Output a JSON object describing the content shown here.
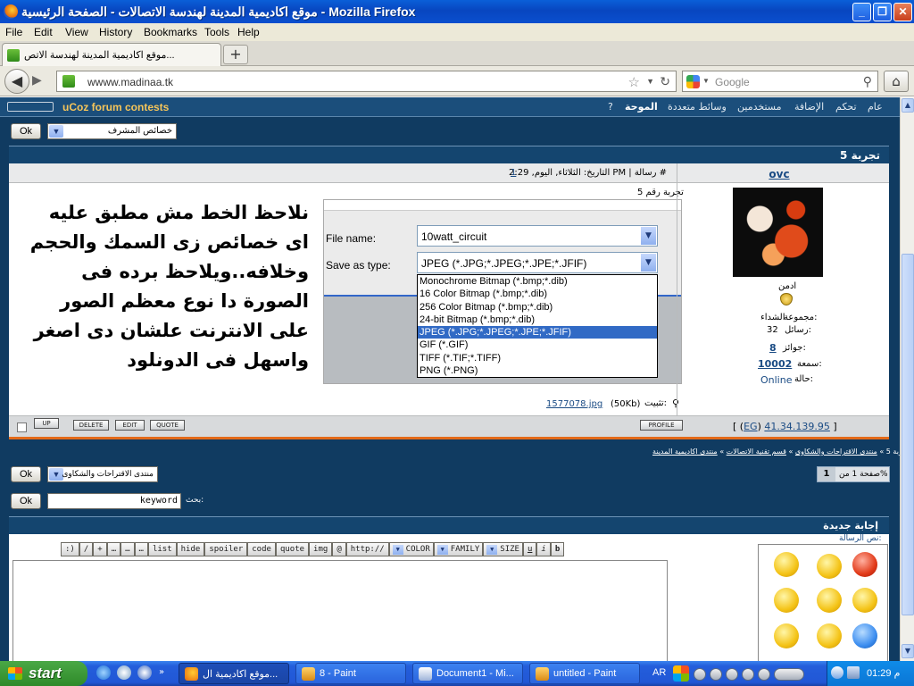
{
  "window": {
    "title": "موقع اكاديمية المدينة لهندسة الاتصالات - الصفحة الرئيسية - Mozilla Firefox",
    "buttons": [
      "_",
      "❐",
      "✕"
    ]
  },
  "menu": {
    "file": "File",
    "edit": "Edit",
    "view": "View",
    "history": "History",
    "bookmarks": "Bookmarks",
    "tools": "Tools",
    "help": "Help"
  },
  "tab": {
    "title": "موقع اكاديمية المدينة لهندسة الاتص...",
    "new_tab": "+"
  },
  "nav": {
    "url": "wwww.madinaa.tk",
    "search_placeholder": "Google"
  },
  "ucoz_bar": {
    "contests": "uCoz forum contests",
    "links": [
      "عام",
      "تحكم",
      "الإضافة",
      "مستخدمين",
      "وسائط متعددة",
      "الموحة"
    ],
    "question": "?"
  },
  "mod_select": {
    "ok": "Ok",
    "value": "خصائص المشرف"
  },
  "post": {
    "title": "تجربة 5",
    "meta": "التاريخ: الثلاثاء, اليوم, 2:29 PM | رسالة #",
    "msg_num": "1",
    "subject": "تجربة رقم 5",
    "note": "نلاحظ الخط مش مطبق عليه اى خصائص زى السمك والحجم وخلافه..ويلاحظ برده فى الصورة دا نوع معظم الصور على الانترنت علشان دى اصغر واسهل فى الدونلود",
    "attachment_label": "تثبيت:",
    "attachment_file": "1577078.jpg",
    "attachment_size": "(50Kb)",
    "save_dialog": {
      "file_name_label": "File name:",
      "file_name_value": "10watt_circuit",
      "save_type_label": "Save as type:",
      "save_type_value": "JPEG (*.JPG;*.JPEG;*.JPE;*.JFIF)",
      "options": [
        "Monochrome Bitmap (*.bmp;*.dib)",
        "16 Color Bitmap (*.bmp;*.dib)",
        "256 Color Bitmap (*.bmp;*.dib)",
        "24-bit Bitmap (*.bmp;*.dib)",
        "JPEG (*.JPG;*.JPEG;*.JPE;*.JFIF)",
        "GIF (*.GIF)",
        "TIFF (*.TIF;*.TIFF)",
        "PNG (*.PNG)"
      ]
    },
    "buttons": {
      "up": "UP",
      "delete": "DELETE",
      "edit": "EDIT",
      "quote": "QUOTE",
      "profile": "PROFILE"
    },
    "ip_prefix": "[ (",
    "ip_eg": "EG",
    "ip_mid": ") ",
    "ip": "41.34.139.95",
    "ip_suffix": " ]"
  },
  "user": {
    "name": "ovc",
    "rank": "ادمن",
    "group_label": "مجموعة:",
    "group": "الشداء",
    "messages_label": "رسائل:",
    "messages": "32",
    "awards_label": "جوائز:",
    "awards": "8",
    "reputation_label": "سمعة:",
    "reputation": "10002",
    "status_label": "حالة:",
    "status": "Online"
  },
  "breadcrumb": {
    "home": "منتدى اكاديمية المدينة",
    "section": "قسم تقنية الاتصالات",
    "forum": "منتدى الاقتراحات والشكاوى",
    "current": "تجربة 5",
    "sep": "»"
  },
  "pager": {
    "label": "صفحة 1 من%",
    "page": "1"
  },
  "forum_jump": {
    "ok": "Ok",
    "value": "منتدى الاقتراحات والشكاوى"
  },
  "search": {
    "ok": "Ok",
    "placeholder": "keyword",
    "label": "بحث:"
  },
  "reply": {
    "title": "إجابة جديدة",
    "text_label": "نص الرسالة:",
    "toolbar": {
      "b": "b",
      "i": "i",
      "u": "u",
      "size": "SIZE",
      "family": "FAMILY",
      "color": "COLOR",
      "http": "http://",
      "at": "@",
      "img": "img",
      "quote": "quote",
      "code": "code",
      "spoiler": "spoiler",
      "hide": "hide",
      "list": "list",
      "dots": "…",
      "slash": "/",
      "plus": "+",
      "smile": ":)"
    }
  },
  "taskbar": {
    "start": "start",
    "tasks": [
      "موقع اكاديمية ال...",
      "8 - Paint",
      "Document1 - Mi...",
      "untitled - Paint"
    ],
    "lang": "AR",
    "clock": "01:29 م"
  },
  "colors": {
    "title_bar": "#0a4fce",
    "forum_bg": "#103b61",
    "header_bar": "#14456f",
    "accent_orange": "#e36a1a",
    "link": "#1a4b84",
    "contests_gold": "#f6c55a"
  }
}
